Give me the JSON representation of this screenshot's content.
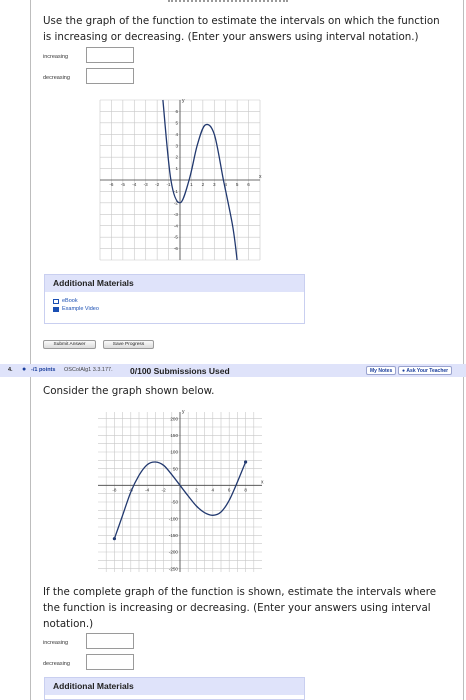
{
  "q1": {
    "prompt_line1": "Use the graph of the function to estimate the intervals on which the function",
    "prompt_line2": "is increasing or decreasing. (Enter your answers using interval notation.)",
    "increasing_label": "increasing",
    "decreasing_label": "decreasing",
    "increasing_value": "",
    "decreasing_value": ""
  },
  "chart_data": [
    {
      "type": "line",
      "xlabel": "x",
      "ylabel": "y",
      "xlim": [
        -7,
        7
      ],
      "ylim": [
        -7,
        7
      ],
      "x_ticks": [
        "-6",
        "-5",
        "-4",
        "-3",
        "-2",
        "-1",
        "1",
        "2",
        "3",
        "4",
        "5",
        "6"
      ],
      "y_ticks": [
        "6",
        "5",
        "4",
        "3",
        "2",
        "1",
        "-1",
        "-2",
        "-3",
        "-4",
        "-5",
        "-6"
      ],
      "series": [
        {
          "x": [
            -1.5,
            -0.8,
            0,
            0.8,
            1.5,
            2.2,
            3,
            3.8,
            4.6,
            5
          ],
          "y": [
            7,
            0,
            -2,
            0,
            3,
            4.8,
            4,
            0,
            -4,
            -7
          ]
        }
      ]
    },
    {
      "type": "line",
      "xlabel": "x",
      "ylabel": "y",
      "xlim": [
        -10,
        10
      ],
      "ylim": [
        -260,
        220
      ],
      "x_ticks": [
        "-8",
        "-6",
        "-4",
        "-2",
        "2",
        "4",
        "6",
        "8"
      ],
      "y_ticks": [
        "200",
        "150",
        "100",
        "50",
        "-50",
        "-100",
        "-150",
        "-200",
        "-250"
      ],
      "series": [
        {
          "x": [
            -8,
            -7,
            -6,
            -5,
            -4,
            -3,
            -2,
            -1,
            0,
            1,
            2,
            3,
            4,
            5,
            6,
            7,
            8
          ],
          "y": [
            -160,
            -90,
            -20,
            30,
            62,
            70,
            60,
            32,
            0,
            -32,
            -62,
            -82,
            -90,
            -80,
            -45,
            10,
            70
          ]
        }
      ]
    }
  ],
  "am1": {
    "title": "Additional Materials",
    "ebook": "eBook",
    "video": "Example Video"
  },
  "buttons": {
    "submit": "Submit Answer",
    "save": "Save Progress"
  },
  "q2header": {
    "number": "4.",
    "points": "-/1 points",
    "code": "OSColAlg1 3.3.177.",
    "submissions": "0/100 Submissions Used",
    "my_notes": "My Notes",
    "ask_teacher": "Ask Your Teacher"
  },
  "q2": {
    "consider": "Consider the graph shown below.",
    "prompt_line1": "If the complete graph of the function is shown, estimate the intervals where",
    "prompt_line2": "the function is increasing or decreasing. (Enter your answers using interval",
    "prompt_line3": "notation.)",
    "increasing_label": "increasing",
    "decreasing_label": "decreasing",
    "increasing_value": "",
    "decreasing_value": ""
  },
  "am2": {
    "title": "Additional Materials"
  },
  "colors": {
    "curve": "#22396f",
    "grid": "#c8c8c8",
    "header_bg": "#dfe3fa"
  }
}
